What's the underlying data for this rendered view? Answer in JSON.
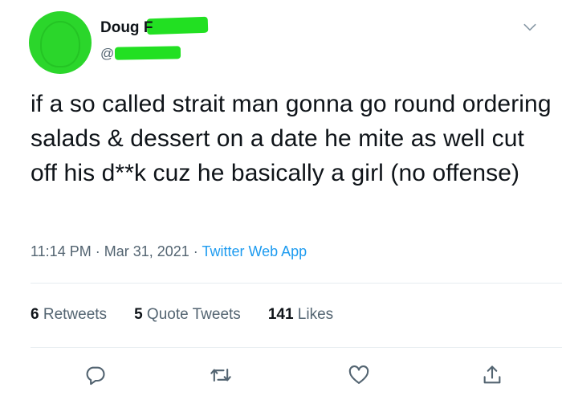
{
  "author": {
    "display_name": "Doug F",
    "handle": "@"
  },
  "tweet": {
    "text": "if a so called strait man gonna go round ordering salads & dessert on a date he mite as well cut off his d**k cuz he basically a girl (no offense)",
    "time": "11:14 PM",
    "date": "Mar 31, 2021",
    "separator": " · ",
    "source": "Twitter Web App"
  },
  "stats": {
    "retweets_count": "6",
    "retweets_label": "Retweets",
    "quote_count": "5",
    "quote_label": "Quote Tweets",
    "likes_count": "141",
    "likes_label": "Likes"
  },
  "icons": {
    "more": "chevron-down-icon",
    "reply": "reply-icon",
    "retweet": "retweet-icon",
    "like": "heart-icon",
    "share": "share-icon"
  },
  "colors": {
    "redaction": "#22e022",
    "link": "#1d9bf0",
    "secondary_text": "#536471",
    "icon": "#536471"
  }
}
